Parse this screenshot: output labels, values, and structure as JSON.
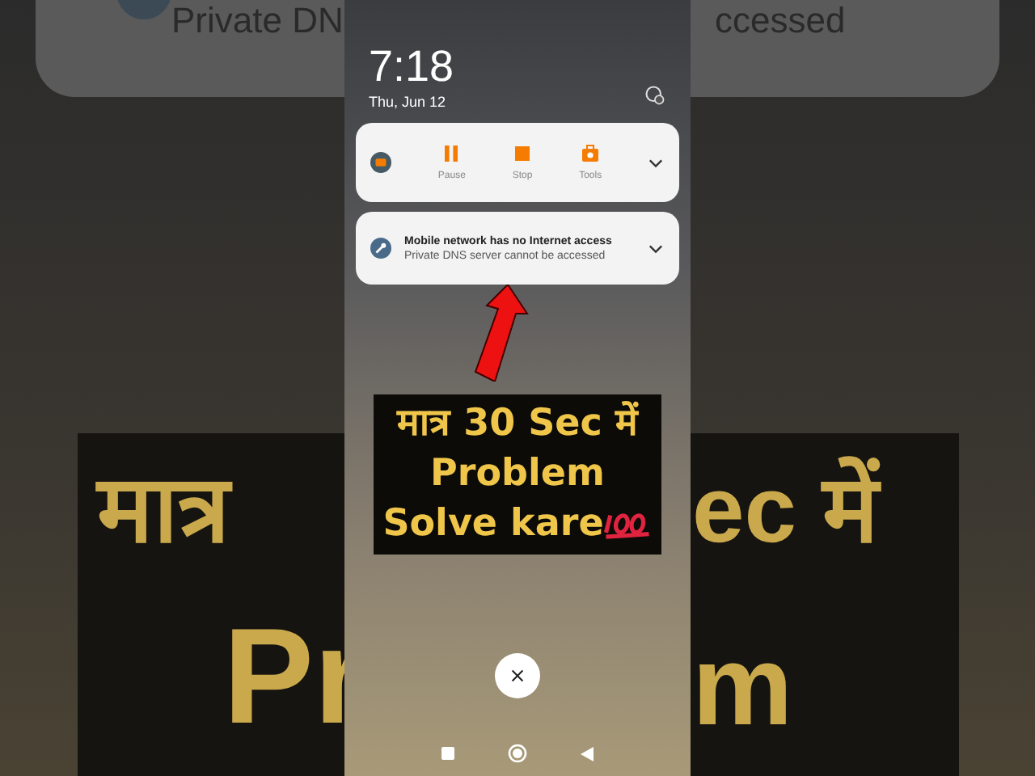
{
  "background": {
    "card_texts": [
      "Private DN",
      "ccessed"
    ],
    "caption_texts": [
      "मात्र",
      "ec में",
      "Pr",
      "m"
    ]
  },
  "phone": {
    "time": "7:18",
    "date": "Thu, Jun 12",
    "media_notification": {
      "actions": [
        {
          "kind": "pause",
          "label": "Pause"
        },
        {
          "kind": "stop",
          "label": "Stop"
        },
        {
          "kind": "tools",
          "label": "Tools"
        }
      ]
    },
    "notification": {
      "title": "Mobile network has no Internet access",
      "body": "Private DNS server cannot be accessed"
    },
    "caption": [
      "मात्र 30 Sec में",
      "Problem",
      "Solve kare"
    ]
  }
}
